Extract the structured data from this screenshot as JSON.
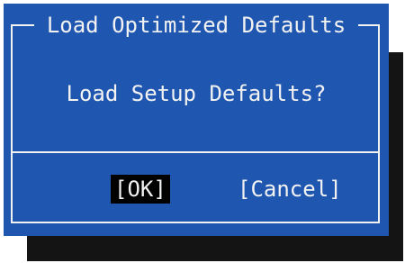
{
  "dialog": {
    "title": "Load Optimized Defaults",
    "message": "Load Setup Defaults?",
    "ok_label": "[OK]",
    "cancel_label": "[Cancel]",
    "selected_button": "ok"
  },
  "colors": {
    "dialog_background": "#1f56b0",
    "text": "#f2f2f2",
    "selected_background": "#000000",
    "shadow": "#141414"
  }
}
